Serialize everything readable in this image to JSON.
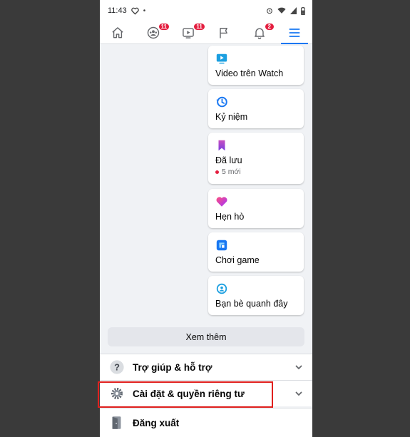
{
  "status_bar": {
    "time": "11:43",
    "dot": "•"
  },
  "tabs": [
    {
      "name": "home",
      "badge": ""
    },
    {
      "name": "groups",
      "badge": "11"
    },
    {
      "name": "watch",
      "badge": "11"
    },
    {
      "name": "pages",
      "badge": ""
    },
    {
      "name": "notifications",
      "badge": "2"
    },
    {
      "name": "menu",
      "badge": ""
    }
  ],
  "shortcuts": [
    {
      "label": "Video trên Watch",
      "icon": "watch-video-icon"
    },
    {
      "label": "Kỷ niệm",
      "icon": "memories-clock-icon"
    },
    {
      "label": "Đã lưu",
      "icon": "saved-bookmark-icon",
      "sub": "5 mới"
    },
    {
      "label": "Hẹn hò",
      "icon": "dating-heart-icon"
    },
    {
      "label": "Chơi game",
      "icon": "gaming-icon"
    },
    {
      "label": "Bạn bè quanh đây",
      "icon": "nearby-friends-icon"
    }
  ],
  "see_more": "Xem thêm",
  "menu_rows": {
    "help": "Trợ giúp & hỗ trợ",
    "settings": "Cài đặt & quyền riêng tư",
    "logout": "Đăng xuất"
  },
  "colors": {
    "accent": "#1877f2",
    "badge": "#e41e3f",
    "highlight_box": "#e0201e",
    "background": "#f0f2f5"
  }
}
